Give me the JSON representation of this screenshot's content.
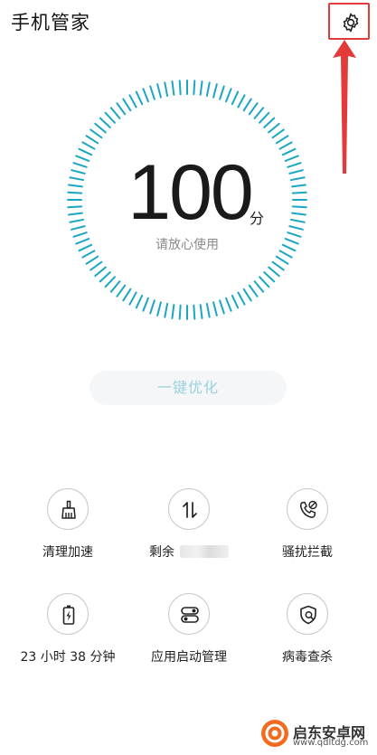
{
  "app": {
    "title": "手机管家"
  },
  "score": {
    "value": "100",
    "unit": "分",
    "status": "请放心使用"
  },
  "optimize_button": {
    "label": "一键优化"
  },
  "tools": [
    {
      "label": "清理加速",
      "icon": "broom-icon"
    },
    {
      "label": "剩余",
      "icon": "data-arrows-icon"
    },
    {
      "label": "骚扰拦截",
      "icon": "phone-block-icon"
    },
    {
      "label": "23 小时 38 分钟",
      "icon": "battery-icon"
    },
    {
      "label": "应用启动管理",
      "icon": "app-launch-icon"
    },
    {
      "label": "病毒查杀",
      "icon": "shield-scan-icon"
    }
  ],
  "watermark": {
    "name": "启东安卓网",
    "url": "www.qdltdg.com"
  },
  "colors": {
    "accent": "#1ba7c4",
    "annotation": "#e33a3a",
    "button_text": "#9bd2de"
  }
}
